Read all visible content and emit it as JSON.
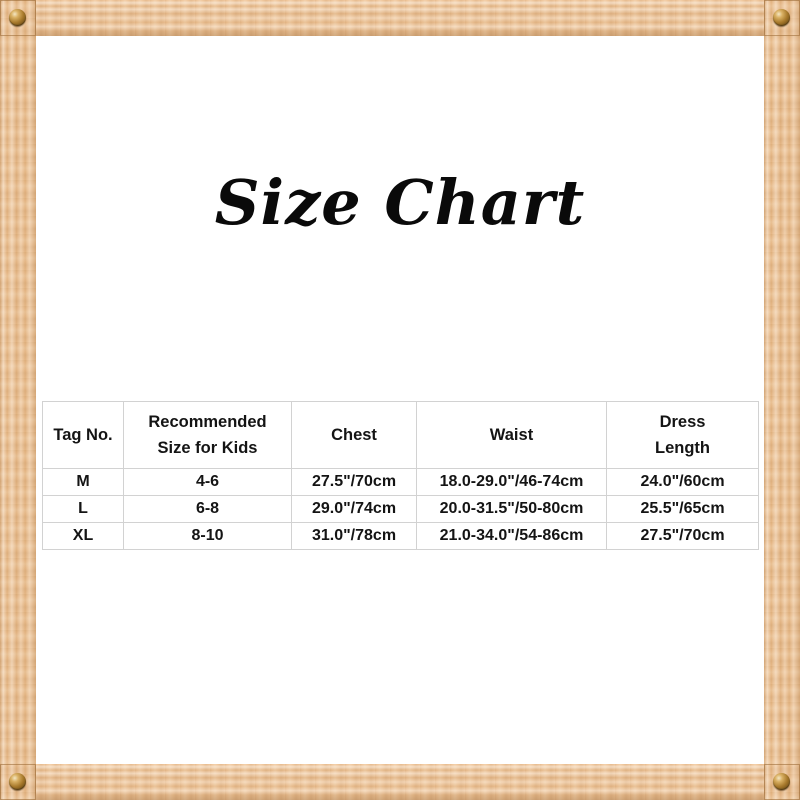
{
  "page": {
    "background_color": "#ffffff",
    "frame_color": "#e8bf8c",
    "screw_color": "#a87a2c"
  },
  "title": "Size Chart",
  "frame": {
    "screws": [
      {
        "name": "screw-top-left"
      },
      {
        "name": "screw-top-right"
      },
      {
        "name": "screw-bottom-left"
      },
      {
        "name": "screw-bottom-right"
      }
    ]
  },
  "table": {
    "headers": {
      "tag_no": "Tag No.",
      "recommended_line1": "Recommended",
      "recommended_line2": "Size for Kids",
      "chest": "Chest",
      "waist": "Waist",
      "dress_line1": "Dress",
      "dress_line2": "Length"
    },
    "rows": [
      {
        "tag_no": "M",
        "size_for_kids": "4-6",
        "chest": "27.5\"/70cm",
        "waist": "18.0-29.0\"/46-74cm",
        "dress_length": "24.0\"/60cm"
      },
      {
        "tag_no": "L",
        "size_for_kids": "6-8",
        "chest": "29.0\"/74cm",
        "waist": "20.0-31.5\"/50-80cm",
        "dress_length": "25.5\"/65cm"
      },
      {
        "tag_no": "XL",
        "size_for_kids": "8-10",
        "chest": "31.0\"/78cm",
        "waist": "21.0-34.0\"/54-86cm",
        "dress_length": "27.5\"/70cm"
      }
    ]
  }
}
